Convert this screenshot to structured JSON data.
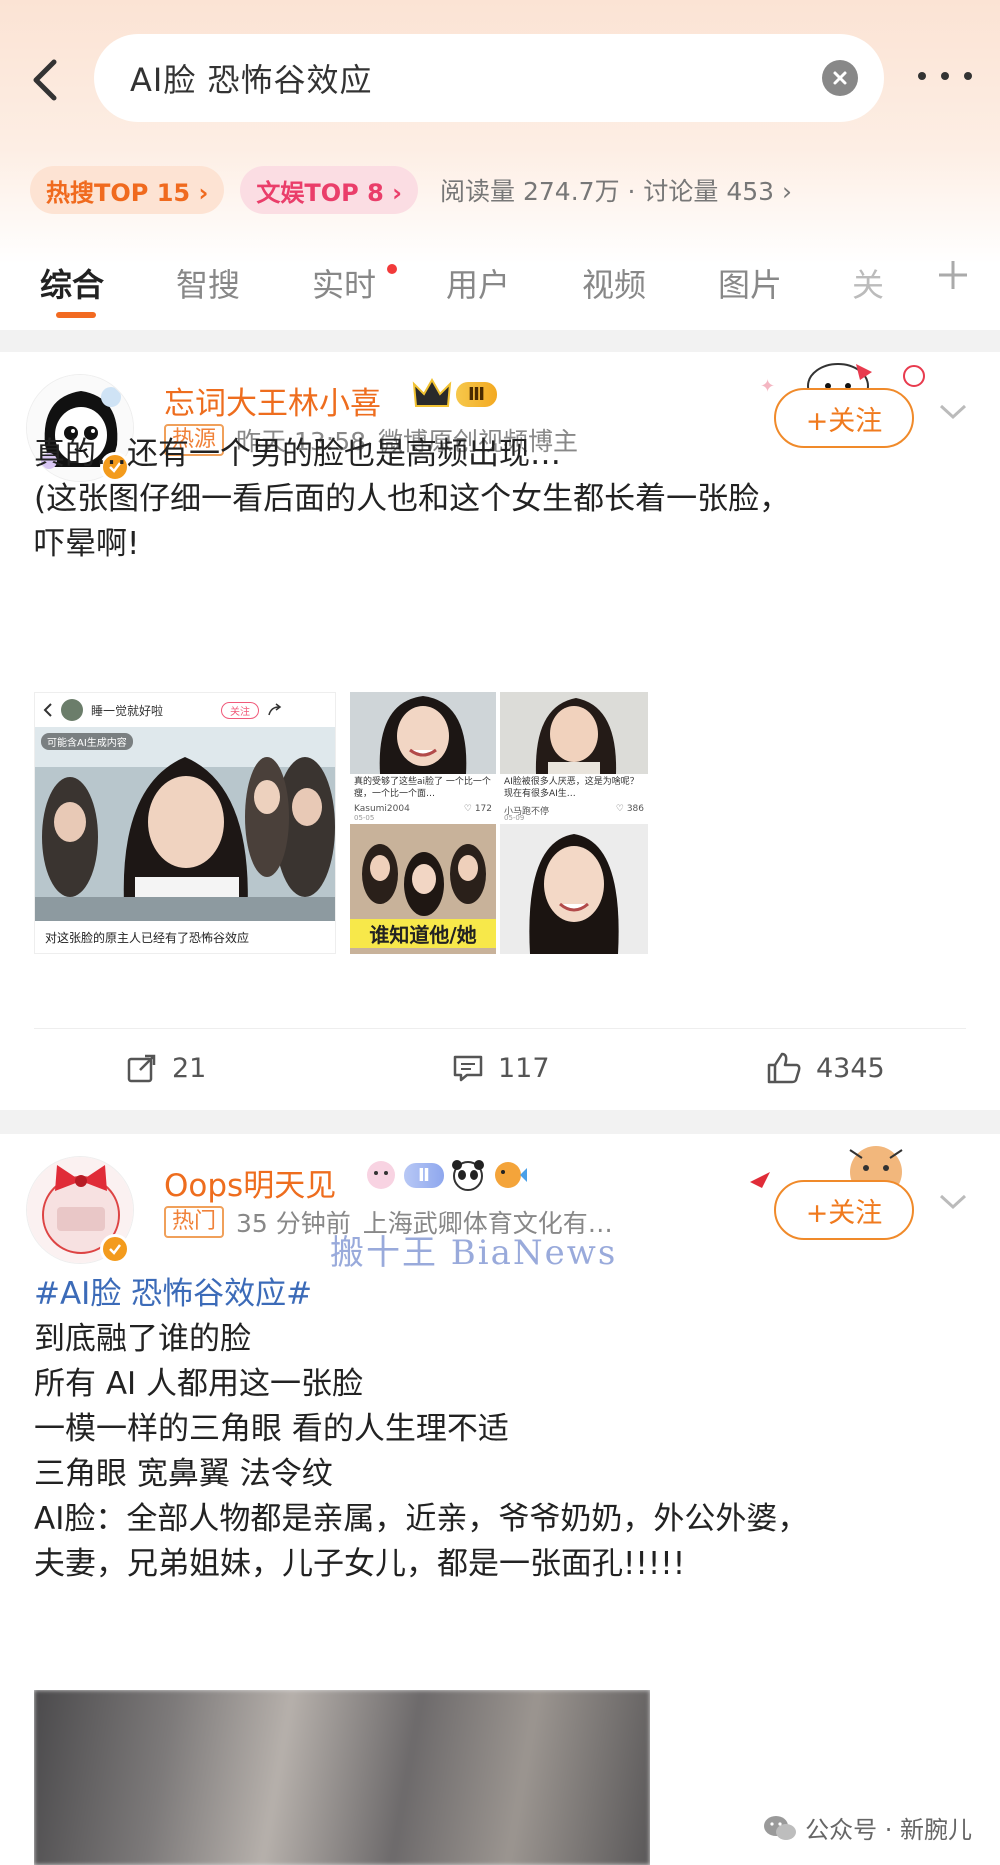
{
  "search": {
    "query": "AI脸 恐怖谷效应"
  },
  "hot_row": {
    "hot_pill": "热搜TOP 15 ›",
    "ent_pill": "文娱TOP 8 ›",
    "stats": "阅读量 274.7万 · 讨论量 453 ›"
  },
  "tabs": [
    "综合",
    "智搜",
    "实时",
    "用户",
    "视频",
    "图片",
    "关"
  ],
  "posts": [
    {
      "username": "忘词大王林小喜",
      "level_badge": "Ⅲ",
      "tag": "热源",
      "time": "昨天 13:58",
      "source": "微博原创视频博主",
      "follow": "+关注",
      "lines": [
        "真的…还有一个男的脸也是高频出现…",
        "(这张图仔细一看后面的人也和这个女生都长着一张脸，",
        "吓晕啊!"
      ],
      "screenshot": {
        "nav_name": "睡一觉就好啦",
        "follow_chip": "关注",
        "ai_notice": "可能含AI生成内容",
        "caption": "对这张脸的原主人已经有了恐怖谷效应"
      },
      "grid": {
        "card1_caption": "真的受够了这些ai脸了 一个比一个瘦，一个比一个面…",
        "card1_user": "Kasumi2004",
        "card1_date": "05-05",
        "card1_likes": "172",
        "card2_caption": "AI脸被很多人厌恶，这是为啥呢？ 现在有很多AI生…",
        "card2_user": "小马跑不停",
        "card2_date": "05-09",
        "card2_likes": "386",
        "card3_caption": "谁知道他/她"
      },
      "reposts": "21",
      "comments": "117",
      "likes": "4345"
    },
    {
      "username": "Oops明天见",
      "level_badge": "Ⅱ",
      "tag": "热门",
      "time": "35 分钟前",
      "source": "上海武卿体育文化有…",
      "follow": "+关注",
      "hashtag": "#AI脸 恐怖谷效应#",
      "lines": [
        "到底融了谁的脸",
        "所有 AI 人都用这一张脸",
        "一模一样的三角眼 看的人生理不适",
        "三角眼 宽鼻翼 法令纹",
        "AI脸：全部人物都是亲属，近亲，爷爷奶奶，外公外婆，",
        "夫妻，兄弟姐妹，儿子女儿，都是一张面孔!!!!!"
      ]
    }
  ],
  "watermark": {
    "center": "搬十王 BiaNews",
    "corner": "公众号 · 新腕儿"
  },
  "colors": {
    "accent": "#f26a21",
    "username": "#ee6d1e",
    "hashtag": "#3c6bb8"
  }
}
